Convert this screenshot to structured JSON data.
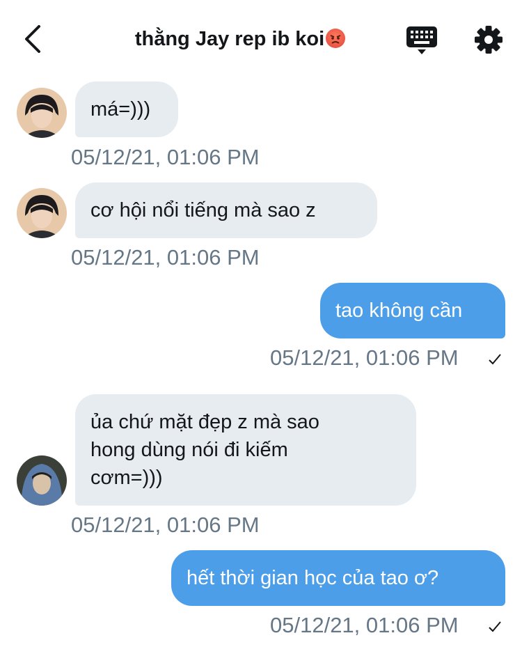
{
  "header": {
    "title": "thằng Jay rep ib koi",
    "title_emoji": "angry-face",
    "back_icon": "chevron-left-icon",
    "keyboard_icon": "keyboard-icon",
    "settings_icon": "gear-icon"
  },
  "colors": {
    "incoming_bubble": "#e6ecf0",
    "outgoing_bubble": "#4d9ee8",
    "timestamp": "#657786"
  },
  "messages": [
    {
      "direction": "incoming",
      "text": "má=)))",
      "time": "05/12/21, 01:06 PM"
    },
    {
      "direction": "incoming",
      "text": "cơ hội nổi tiếng mà sao z",
      "time": "05/12/21, 01:06 PM"
    },
    {
      "direction": "outgoing",
      "text": "tao không cần",
      "time": "05/12/21, 01:06 PM",
      "status": "✓"
    },
    {
      "direction": "incoming",
      "lines": [
        "ủa chứ mặt đẹp z mà sao",
        "hong dùng nói đi kiếm",
        "cơm=)))"
      ],
      "time": "05/12/21, 01:06 PM"
    },
    {
      "direction": "outgoing",
      "text": "hết thời gian học của tao ơ?",
      "time": "05/12/21, 01:06 PM",
      "status": "✓"
    }
  ]
}
